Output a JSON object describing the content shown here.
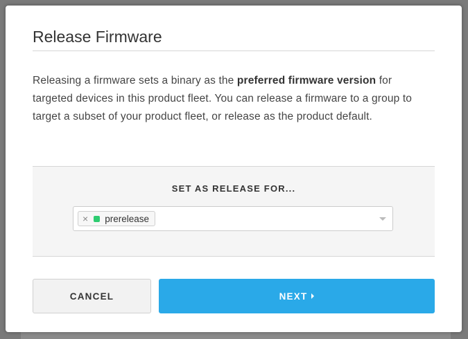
{
  "modal": {
    "title": "Release Firmware",
    "description": {
      "before": "Releasing a firmware sets a binary as the ",
      "emphasis": "preferred firmware version",
      "after": " for targeted devices in this product fleet. You can release a firmware to a group to target a subset of your product fleet, or release as the product default."
    },
    "release_section": {
      "label": "SET AS RELEASE FOR...",
      "selected_groups": [
        {
          "name": "prerelease",
          "color": "#2ecc71",
          "remove_icon": "×"
        }
      ]
    },
    "buttons": {
      "cancel_label": "CANCEL",
      "next_label": "NEXT"
    }
  },
  "colors": {
    "accent": "#2aa9e8",
    "group_tag": "#2ecc71"
  }
}
